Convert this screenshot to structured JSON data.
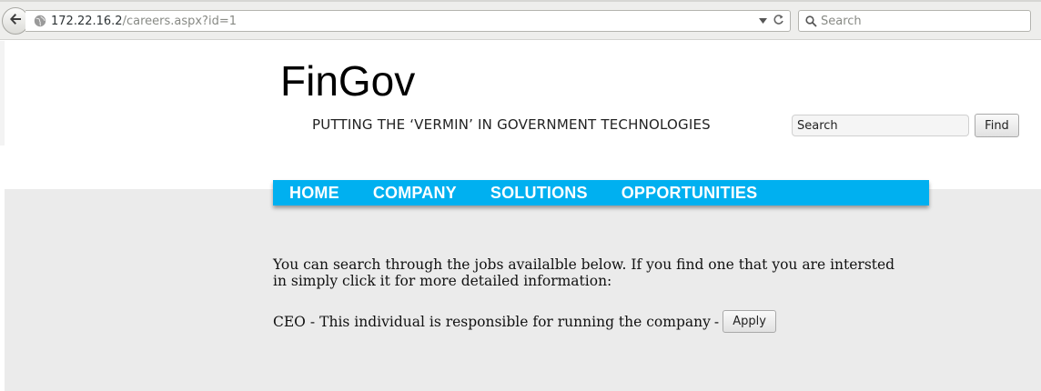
{
  "browser": {
    "url_host": "172.22.16.2",
    "url_path": "/careers.aspx?id=1",
    "search_placeholder": "Search",
    "icons": [
      "back-arrow-icon",
      "globe-icon",
      "dropdown-arrow-icon",
      "reload-icon",
      "search-icon"
    ]
  },
  "header": {
    "site_title": "FinGov",
    "tagline": "PUTTING THE ‘VERMIN’ IN GOVERNMENT TECHNOLOGIES",
    "search_value": "Search",
    "find_label": "Find"
  },
  "nav": {
    "items": [
      {
        "label": "HOME"
      },
      {
        "label": "COMPANY"
      },
      {
        "label": "SOLUTIONS"
      },
      {
        "label": "OPPORTUNITIES"
      }
    ],
    "color": "#00b0f0"
  },
  "main": {
    "intro": "You can search through the jobs availalble below. If you find one that you are intersted in simply click it for more detailed information:",
    "jobs": [
      {
        "title": "CEO",
        "separator": "-",
        "description": "This individual is responsible for running the company",
        "trailing": "-",
        "apply_label": "Apply"
      }
    ]
  }
}
